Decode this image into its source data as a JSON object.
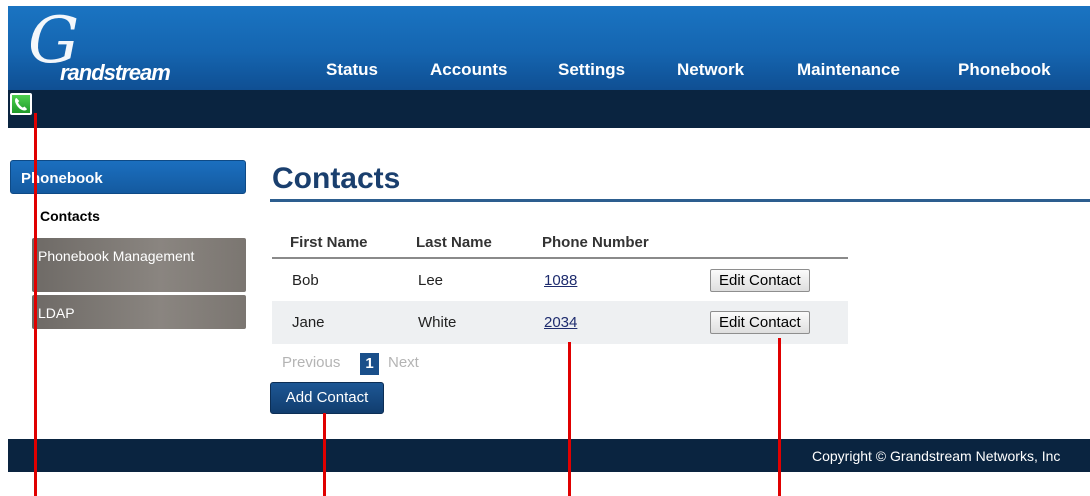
{
  "brand": {
    "logo_letter": "G",
    "logo_text": "randstream"
  },
  "nav": {
    "items": [
      "Status",
      "Accounts",
      "Settings",
      "Network",
      "Maintenance",
      "Phonebook"
    ]
  },
  "sidebar": {
    "header": "Phonebook",
    "items": [
      {
        "label": "Contacts"
      },
      {
        "label": "Phonebook Management"
      },
      {
        "label": "LDAP"
      }
    ]
  },
  "main": {
    "title": "Contacts",
    "table": {
      "columns": [
        "First Name",
        "Last Name",
        "Phone Number"
      ],
      "rows": [
        {
          "first": "Bob",
          "last": "Lee",
          "phone": "1088",
          "action": "Edit Contact"
        },
        {
          "first": "Jane",
          "last": "White",
          "phone": "2034",
          "action": "Edit Contact"
        }
      ]
    },
    "pager": {
      "previous": "Previous",
      "current_page": "1",
      "next": "Next"
    },
    "add_button": "Add Contact"
  },
  "footer": {
    "copyright": "Copyright © Grandstream Networks, Inc"
  },
  "colors": {
    "header_blue": "#1565b0",
    "dark_navy": "#0a2440",
    "title_blue": "#1a3f6e",
    "annotation_red": "#e00000",
    "phone_green": "#2fb83a"
  },
  "icons": {
    "call_button": "phone-handset-icon"
  }
}
